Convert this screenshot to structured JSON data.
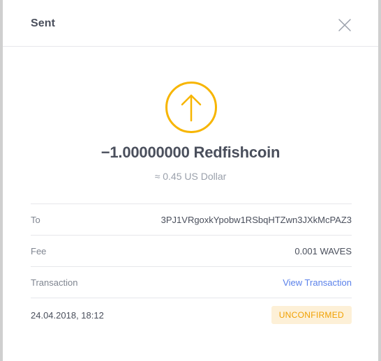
{
  "modal": {
    "title": "Sent",
    "close_icon": "close-icon"
  },
  "transaction": {
    "direction_icon": "arrow-up-icon",
    "accent_color": "#f7b500",
    "amount": "−1.00000000 Redfishcoin",
    "fiat_value": "≈ 0.45 US Dollar"
  },
  "details": {
    "to_label": "To",
    "to_value": "3PJ1VRgoxkYpobw1RSbqHTZwn3JXkMcPAZ3",
    "fee_label": "Fee",
    "fee_value": "0.001 WAVES",
    "transaction_label": "Transaction",
    "transaction_link": "View Transaction",
    "timestamp": "24.04.2018, 18:12",
    "status": "UNCONFIRMED"
  }
}
